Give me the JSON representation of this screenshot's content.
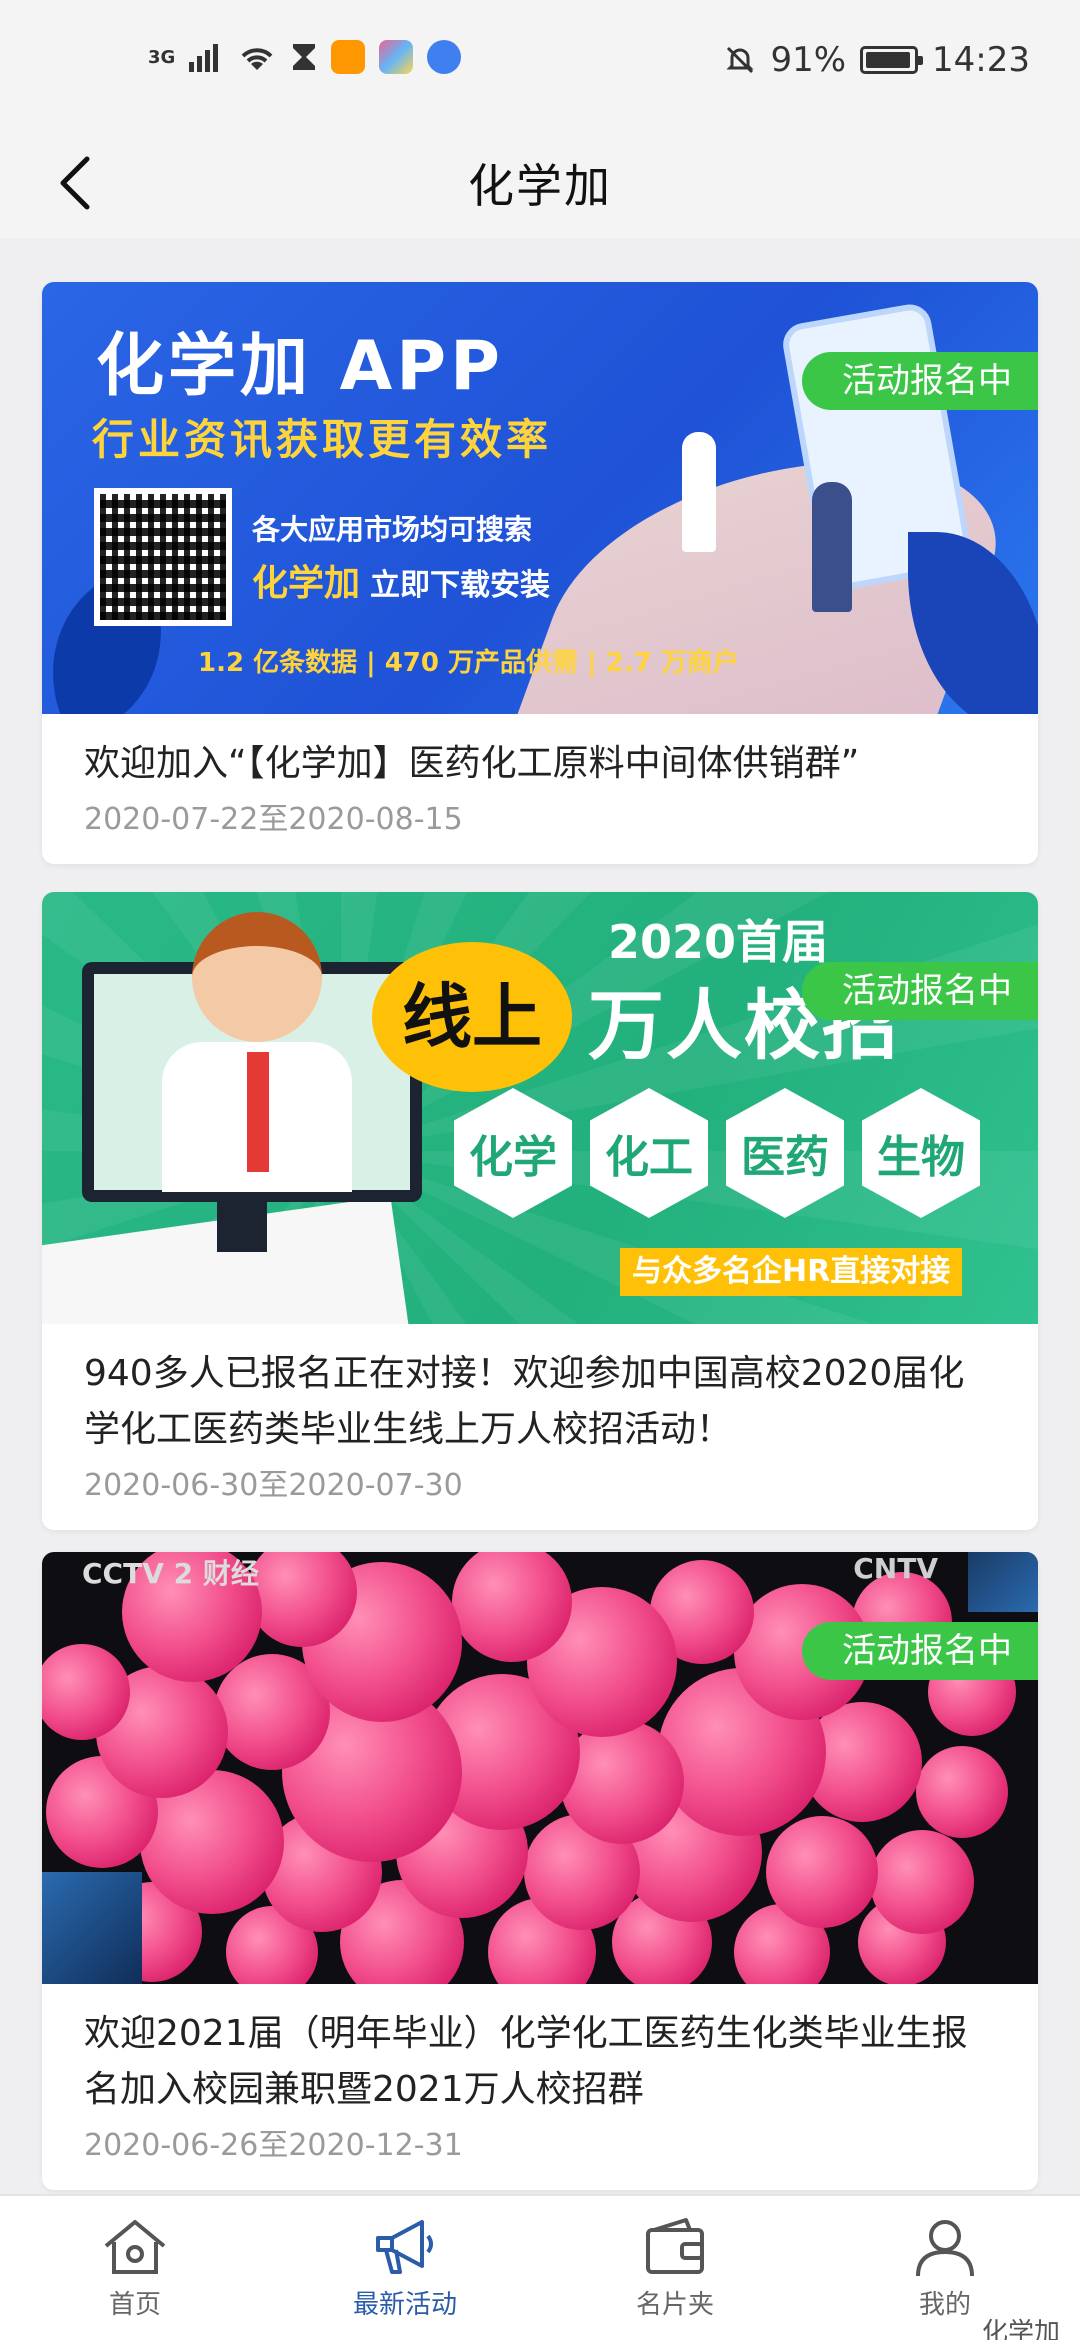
{
  "status_bar": {
    "network": "3G",
    "battery": "91%",
    "time": "14:23"
  },
  "header": {
    "title": "化学加"
  },
  "badge_label": "活动报名中",
  "cards": [
    {
      "title": "欢迎加入“【化学加】医药化工原料中间体供销群”",
      "date": "2020-07-22至2020-08-15",
      "banner": {
        "title": "化学加 APP",
        "subtitle": "行业资讯获取更有效率",
        "line1": "各大应用市场均可搜索",
        "brand": "化学加",
        "line2": "立即下载安装",
        "stats": "1.2 亿条数据 | 470 万产品供需 | 2.7 万商户"
      }
    },
    {
      "title": "940多人已报名正在对接！欢迎参加中国高校2020届化学化工医药类毕业生线上万人校招活动！",
      "date": "2020-06-30至2020-07-30",
      "banner": {
        "year": "2020首届",
        "online": "线上",
        "big": "万人校招",
        "hexes": [
          "化学",
          "化工",
          "医药",
          "生物"
        ],
        "cta": "与众多名企HR直接对接"
      }
    },
    {
      "title": "欢迎2021届（明年毕业）化学化工医药生化类毕业生报名加入校园兼职暨2021万人校招群",
      "date": "2020-06-26至2020-12-31",
      "banner": {
        "logo_left": "CCTV 2 财经",
        "logo_right": "CNTV"
      }
    }
  ],
  "tab_bar": {
    "tabs": [
      {
        "label": "首页",
        "icon": "home-icon"
      },
      {
        "label": "最新活动",
        "icon": "megaphone-icon"
      },
      {
        "label": "名片夹",
        "icon": "wallet-icon"
      },
      {
        "label": "我的",
        "icon": "user-icon"
      }
    ],
    "active_index": 1
  },
  "watermark": "化学加",
  "colors": {
    "badge": "#3cc648",
    "active_tab": "#2a5caa",
    "inactive_tab": "#666666"
  }
}
